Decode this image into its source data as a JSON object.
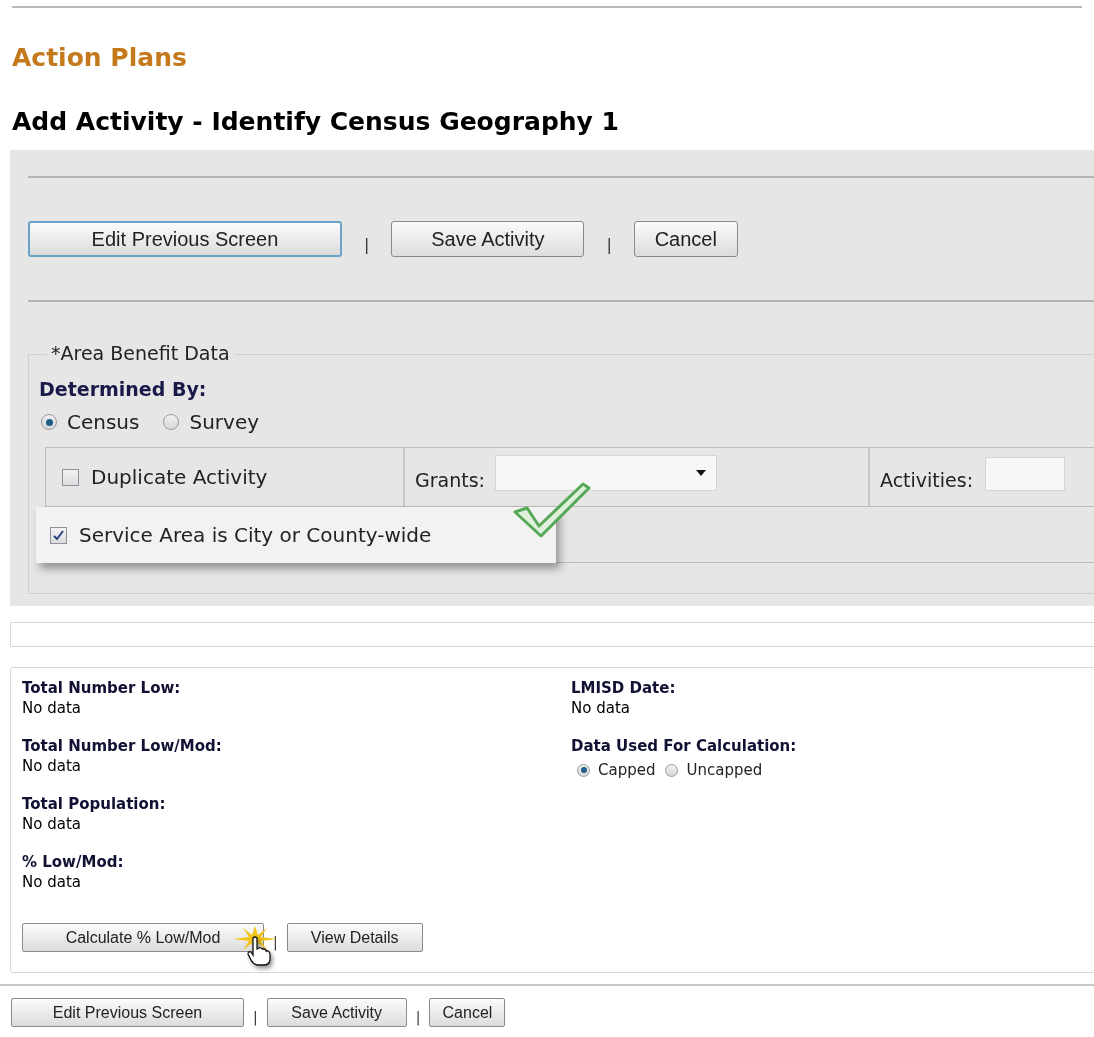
{
  "title": "Action Plans",
  "subtitle": "Add Activity - Identify Census Geography 1",
  "top_buttons": [
    {
      "label": "Edit Previous Screen",
      "focused": true
    },
    {
      "label": "Save Activity",
      "focused": false,
      "separator": "|"
    },
    {
      "label": "Cancel",
      "focused": false,
      "separator": "|"
    }
  ],
  "area_benefit": {
    "legend": "*Area Benefit Data",
    "determined_by": "Determined By:",
    "options": [
      {
        "label": "Census",
        "selected": true
      },
      {
        "label": "Survey",
        "selected": false
      }
    ],
    "duplicate": {
      "label": "Duplicate Activity",
      "checked": false
    },
    "grants_label": "Grants:",
    "activities_label": "Activities:",
    "service_area": {
      "label": "Service Area is City or County-wide",
      "checked": true
    }
  },
  "fields": [
    {
      "label": "Total Number Low:",
      "value": "No data"
    },
    {
      "label": "Total Number Low/Mod:",
      "value": "No data"
    },
    {
      "label": "Total Population:",
      "value": "No data"
    },
    {
      "label": "% Low/Mod:",
      "value": "No data"
    }
  ],
  "lmisd": {
    "label": "LMISD Date:",
    "value": "No data"
  },
  "calculation": {
    "label": "Data Used For Calculation:",
    "options": [
      {
        "label": "Capped",
        "selected": true
      },
      {
        "label": "Uncapped",
        "selected": false
      }
    ]
  },
  "panel_buttons": [
    {
      "label": "Calculate % Low/Mod"
    },
    {
      "label": "View Details",
      "separator": "|"
    }
  ],
  "bottom_buttons": [
    {
      "label": "Edit Previous Screen"
    },
    {
      "label": "Save Activity",
      "separator": "|"
    },
    {
      "label": "Cancel",
      "separator": "|"
    }
  ]
}
